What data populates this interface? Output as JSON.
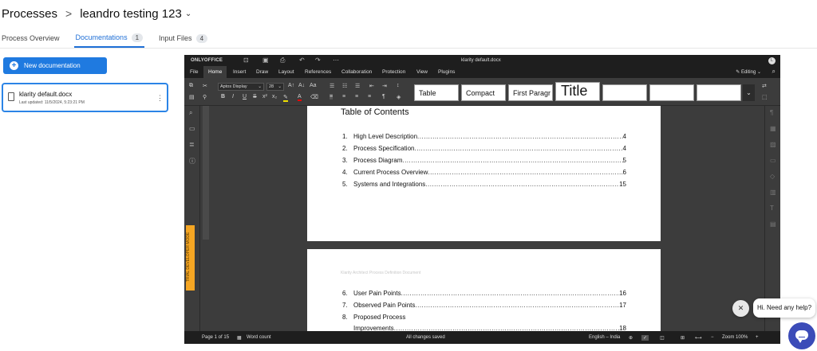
{
  "header": {
    "breadcrumb_root": "Processes",
    "separator": ">",
    "process_name": "leandro testing 123"
  },
  "tabs": [
    {
      "label": "Process Overview",
      "badge": ""
    },
    {
      "label": "Documentations",
      "badge": "1"
    },
    {
      "label": "Input Files",
      "badge": "4"
    }
  ],
  "left": {
    "new_button": "New documentation",
    "doc": {
      "name": "klarity default.docx",
      "updated": "Last updated: 11/5/2024, 5:23:21 PM"
    }
  },
  "editor": {
    "brand": "ONLYOFFICE",
    "doc_title": "klarity default.docx",
    "avatar": "L",
    "menu": [
      "File",
      "Home",
      "Insert",
      "Draw",
      "Layout",
      "References",
      "Collaboration",
      "Protection",
      "View",
      "Plugins"
    ],
    "mode": "Editing",
    "font": "Aptos Display",
    "font_size": "28",
    "styles": [
      "Table",
      "Compact",
      "First Paragr",
      "Title",
      "",
      "",
      ""
    ],
    "trial_label": "TRIAL DEVELOPER MODE",
    "page1": {
      "heading": "Table of Contents",
      "rows": [
        {
          "num": "1.",
          "title": "High Level Description",
          "page": "4"
        },
        {
          "num": "2.",
          "title": "Process Specification",
          "page": "4"
        },
        {
          "num": "3.",
          "title": "Process Diagram",
          "page": "5"
        },
        {
          "num": "4.",
          "title": "Current Process Overview",
          "page": "6"
        },
        {
          "num": "5.",
          "title": "Systems and Integrations",
          "page": "15"
        }
      ]
    },
    "page2": {
      "header_text": "Klarity Architect Process Definition Document",
      "rows": [
        {
          "num": "6.",
          "title": "User Pain Points",
          "page": "16"
        },
        {
          "num": "7.",
          "title": "Observed Pain Points",
          "page": "17"
        },
        {
          "num": "8.",
          "title": "Proposed Process",
          "page": ""
        },
        {
          "num": "",
          "title": "Improvements",
          "page": "18"
        }
      ]
    },
    "status": {
      "page": "Page 1 of 15",
      "word_count": "Word count",
      "changes": "All changes saved",
      "language": "English – India",
      "zoom": "Zoom 100%"
    }
  },
  "chat": {
    "prompt": "Hi. Need any help?"
  }
}
